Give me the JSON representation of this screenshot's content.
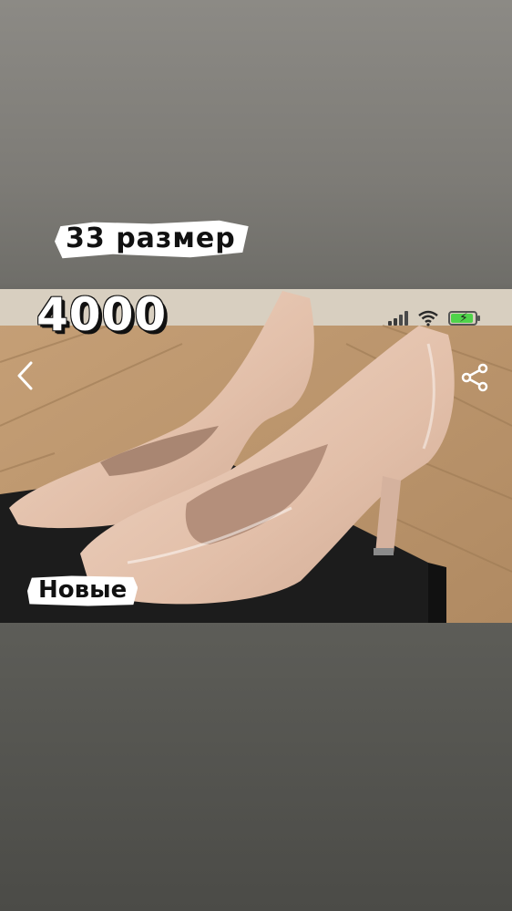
{
  "stickers": {
    "size": "33 размер",
    "price": "4000",
    "condition": "Новые"
  },
  "icons": {
    "back": "chevron-left-icon",
    "share": "share-icon",
    "signal": "cellular-signal-icon",
    "wifi": "wifi-icon",
    "battery": "battery-charging-icon"
  },
  "status_bar": {
    "battery_level": 0.85,
    "battery_color": "#4fd34a"
  },
  "colors": {
    "background_top": "#8c8a85",
    "background_bottom": "#4b4b47",
    "shoe": "#e4c3ae"
  }
}
